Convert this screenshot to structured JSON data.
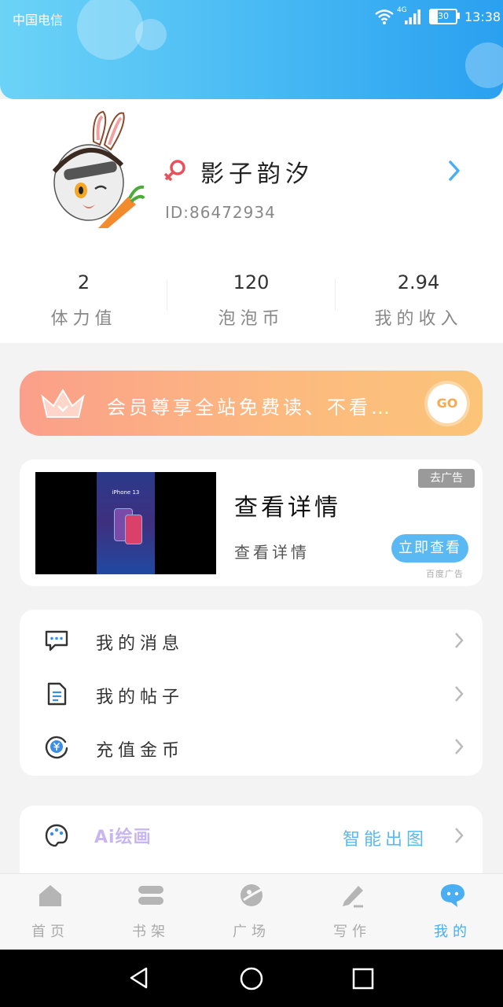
{
  "status_bar": {
    "carrier": "中国电信",
    "network": "4G",
    "battery": "30",
    "time": "13:38"
  },
  "profile": {
    "username": "影子韵汐",
    "user_id": "ID:86472934",
    "stats": [
      {
        "value": "2",
        "label": "体力值"
      },
      {
        "value": "120",
        "label": "泡泡币"
      },
      {
        "value": "2.94",
        "label": "我的收入"
      }
    ]
  },
  "vip_banner": {
    "text": "会员尊享全站免费读、不看…",
    "go_label": "GO"
  },
  "ad": {
    "tag": "去广告",
    "title": "查看详情",
    "subtitle": "查看详情",
    "button": "立即查看",
    "source": "百度广告",
    "thumb_text": "iPhone 13"
  },
  "menu": {
    "items": [
      {
        "label": "我的消息",
        "icon": "message-icon"
      },
      {
        "label": "我的帖子",
        "icon": "document-icon"
      },
      {
        "label": "充值金币",
        "icon": "coin-icon"
      }
    ]
  },
  "ai": {
    "badge": "Ai绘画",
    "action": "智能出图"
  },
  "tabs": [
    {
      "label": "首页",
      "icon": "home-icon",
      "active": false
    },
    {
      "label": "书架",
      "icon": "bookshelf-icon",
      "active": false
    },
    {
      "label": "广场",
      "icon": "planet-icon",
      "active": false
    },
    {
      "label": "写作",
      "icon": "pen-icon",
      "active": false
    },
    {
      "label": "我的",
      "icon": "chat-bubble-icon",
      "active": true
    }
  ],
  "colors": {
    "accent": "#4aaef2",
    "header_start": "#6cd3f7",
    "header_end": "#2aa0f0",
    "vip_start": "#fb9f8a",
    "vip_end": "#fbc478"
  }
}
